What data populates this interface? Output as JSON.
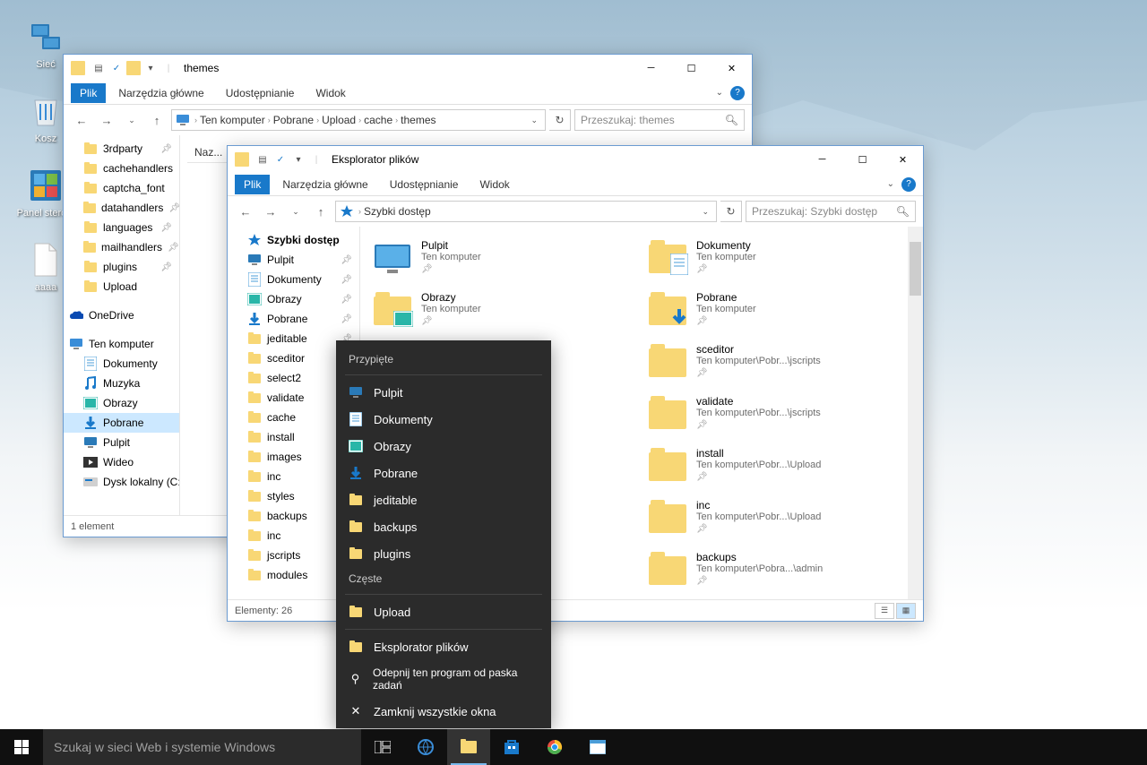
{
  "desktop": {
    "icons": [
      {
        "name": "Sieć",
        "type": "network"
      },
      {
        "name": "Kosz",
        "type": "recycle"
      },
      {
        "name": "Panel stero...",
        "type": "control"
      },
      {
        "name": "aaaa",
        "type": "file"
      }
    ]
  },
  "window1": {
    "title": "themes",
    "ribbon": {
      "file": "Plik",
      "tabs": [
        "Narzędzia główne",
        "Udostępnianie",
        "Widok"
      ]
    },
    "breadcrumb": [
      "Ten komputer",
      "Pobrane",
      "Upload",
      "cache",
      "themes"
    ],
    "search_placeholder": "Przeszukaj: themes",
    "header": "Naz...",
    "tree": [
      {
        "name": "3rdparty",
        "type": "folder",
        "pin": true
      },
      {
        "name": "cachehandlers",
        "type": "folder"
      },
      {
        "name": "captcha_font",
        "type": "folder"
      },
      {
        "name": "datahandlers",
        "type": "folder",
        "pin": true
      },
      {
        "name": "languages",
        "type": "folder",
        "pin": true
      },
      {
        "name": "mailhandlers",
        "type": "folder",
        "pin": true
      },
      {
        "name": "plugins",
        "type": "folder",
        "pin": true
      },
      {
        "name": "Upload",
        "type": "folder"
      },
      {
        "name": "OneDrive",
        "type": "onedrive",
        "indent": -1,
        "spacer": true
      },
      {
        "name": "Ten komputer",
        "type": "pc",
        "indent": -1,
        "spacer": true
      },
      {
        "name": "Dokumenty",
        "type": "doc"
      },
      {
        "name": "Muzyka",
        "type": "music"
      },
      {
        "name": "Obrazy",
        "type": "image"
      },
      {
        "name": "Pobrane",
        "type": "download",
        "selected": true
      },
      {
        "name": "Pulpit",
        "type": "desktop"
      },
      {
        "name": "Wideo",
        "type": "video"
      },
      {
        "name": "Dysk lokalny (C:)",
        "type": "disk"
      }
    ],
    "status": "1 element"
  },
  "window2": {
    "title": "Eksplorator plików",
    "ribbon": {
      "file": "Plik",
      "tabs": [
        "Narzędzia główne",
        "Udostępnianie",
        "Widok"
      ]
    },
    "breadcrumb_single": "Szybki dostęp",
    "search_placeholder": "Przeszukaj: Szybki dostęp",
    "tree": [
      {
        "name": "Szybki dostęp",
        "type": "quick",
        "bold": true
      },
      {
        "name": "Pulpit",
        "type": "desktop",
        "pin": true
      },
      {
        "name": "Dokumenty",
        "type": "doc",
        "pin": true
      },
      {
        "name": "Obrazy",
        "type": "image",
        "pin": true
      },
      {
        "name": "Pobrane",
        "type": "download",
        "pin": true
      },
      {
        "name": "jeditable",
        "type": "folder",
        "pin": true
      },
      {
        "name": "sceditor",
        "type": "folder",
        "pin": true
      },
      {
        "name": "select2",
        "type": "folder",
        "pin": true
      },
      {
        "name": "validate",
        "type": "folder",
        "pin": true
      },
      {
        "name": "cache",
        "type": "folder",
        "pin": true
      },
      {
        "name": "install",
        "type": "folder",
        "pin": true
      },
      {
        "name": "images",
        "type": "folder",
        "pin": true
      },
      {
        "name": "inc",
        "type": "folder",
        "pin": true
      },
      {
        "name": "styles",
        "type": "folder",
        "pin": true
      },
      {
        "name": "backups",
        "type": "folder",
        "pin": true
      },
      {
        "name": "inc",
        "type": "folder",
        "pin": true
      },
      {
        "name": "jscripts",
        "type": "folder",
        "pin": true
      },
      {
        "name": "modules",
        "type": "folder",
        "pin": true
      }
    ],
    "items_left": [
      {
        "name": "Pulpit",
        "sub": "Ten komputer",
        "type": "desktop",
        "pin": true
      },
      {
        "name": "Obrazy",
        "sub": "Ten komputer",
        "type": "image",
        "pin": true
      }
    ],
    "items_right": [
      {
        "name": "Dokumenty",
        "sub": "Ten komputer",
        "type": "doc",
        "pin": true
      },
      {
        "name": "Pobrane",
        "sub": "Ten komputer",
        "type": "download",
        "pin": true
      },
      {
        "name": "sceditor",
        "sub": "Ten komputer\\Pobr...\\jscripts",
        "type": "folder",
        "pin": true
      },
      {
        "name": "validate",
        "sub": "Ten komputer\\Pobr...\\jscripts",
        "type": "folder",
        "pin": true
      },
      {
        "name": "install",
        "sub": "Ten komputer\\Pobr...\\Upload",
        "type": "folder",
        "pin": true
      },
      {
        "name": "inc",
        "sub": "Ten komputer\\Pobr...\\Upload",
        "type": "folder",
        "pin": true
      },
      {
        "name": "backups",
        "sub": "Ten komputer\\Pobra...\\admin",
        "type": "folder",
        "pin": true
      }
    ],
    "status": "Elementy: 26"
  },
  "jumplist": {
    "pinned_header": "Przypięte",
    "pinned": [
      {
        "name": "Pulpit",
        "type": "desktop"
      },
      {
        "name": "Dokumenty",
        "type": "doc"
      },
      {
        "name": "Obrazy",
        "type": "image"
      },
      {
        "name": "Pobrane",
        "type": "download"
      },
      {
        "name": "jeditable",
        "type": "folder"
      },
      {
        "name": "backups",
        "type": "folder"
      },
      {
        "name": "plugins",
        "type": "folder"
      }
    ],
    "frequent_header": "Częste",
    "frequent": [
      {
        "name": "Upload",
        "type": "folder"
      }
    ],
    "app": "Eksplorator plików",
    "unpin": "Odepnij ten program od paska zadań",
    "close": "Zamknij wszystkie okna"
  },
  "taskbar": {
    "search": "Szukaj w sieci Web i systemie Windows"
  }
}
